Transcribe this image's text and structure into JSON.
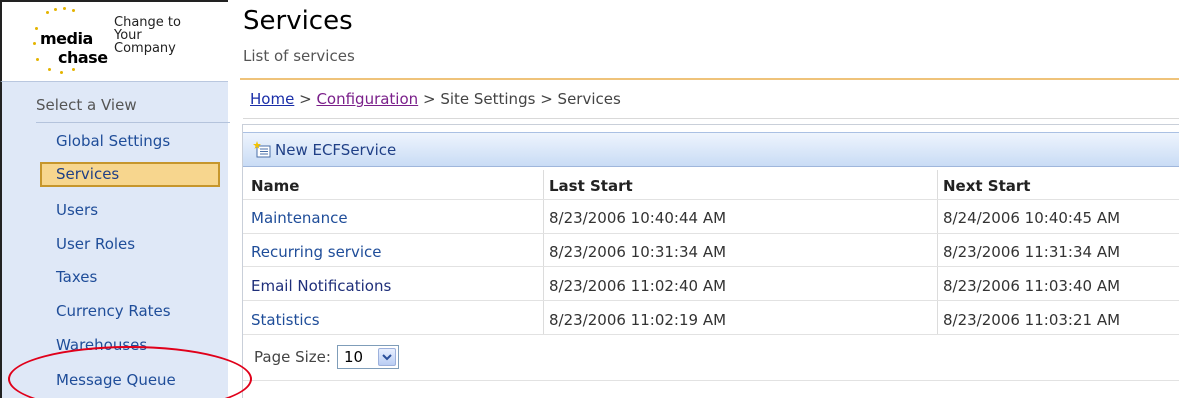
{
  "logo": {
    "word_1": "media",
    "word_2": "chase",
    "tagline_1": "Change to",
    "tagline_2": "Your",
    "tagline_3": "Company",
    "dot_color": "#e4b400"
  },
  "header": {
    "title": "Services",
    "subtitle": "List of services"
  },
  "sidebar": {
    "heading": "Select a View",
    "items": [
      {
        "label": "Global Settings",
        "selected": false
      },
      {
        "label": "Services",
        "selected": true
      },
      {
        "label": "Users",
        "selected": false
      },
      {
        "label": "User Roles",
        "selected": false
      },
      {
        "label": "Taxes",
        "selected": false
      },
      {
        "label": "Currency Rates",
        "selected": false
      },
      {
        "label": "Warehouses",
        "selected": false
      },
      {
        "label": "Message Queue",
        "selected": false
      }
    ]
  },
  "breadcrumb": {
    "home": "Home",
    "configuration": "Configuration",
    "separator": ">",
    "site_settings": "Site Settings",
    "current": "Services"
  },
  "toolbar": {
    "new_label": "New ECFService",
    "icon": "new-item-icon"
  },
  "table": {
    "columns": [
      "Name",
      "Last Start",
      "Next Start"
    ],
    "rows": [
      {
        "name": "Maintenance",
        "last_start": "8/23/2006 10:40:44 AM",
        "next_start": "8/24/2006 10:40:45 AM"
      },
      {
        "name": "Recurring service",
        "last_start": "8/23/2006 10:31:34 AM",
        "next_start": "8/23/2006 11:31:34 AM"
      },
      {
        "name": "Email Notifications",
        "last_start": "8/23/2006 11:02:40 AM",
        "next_start": "8/23/2006 11:03:40 AM"
      },
      {
        "name": "Statistics",
        "last_start": "8/23/2006 11:02:19 AM",
        "next_start": "8/23/2006 11:03:21 AM"
      }
    ]
  },
  "pager": {
    "label": "Page Size:",
    "value": "10"
  },
  "colors": {
    "link": "#1f4d99",
    "selected_bg": "#f7d68e",
    "sidebar_bg": "#dfe8f7",
    "callout": "#e0001a"
  }
}
